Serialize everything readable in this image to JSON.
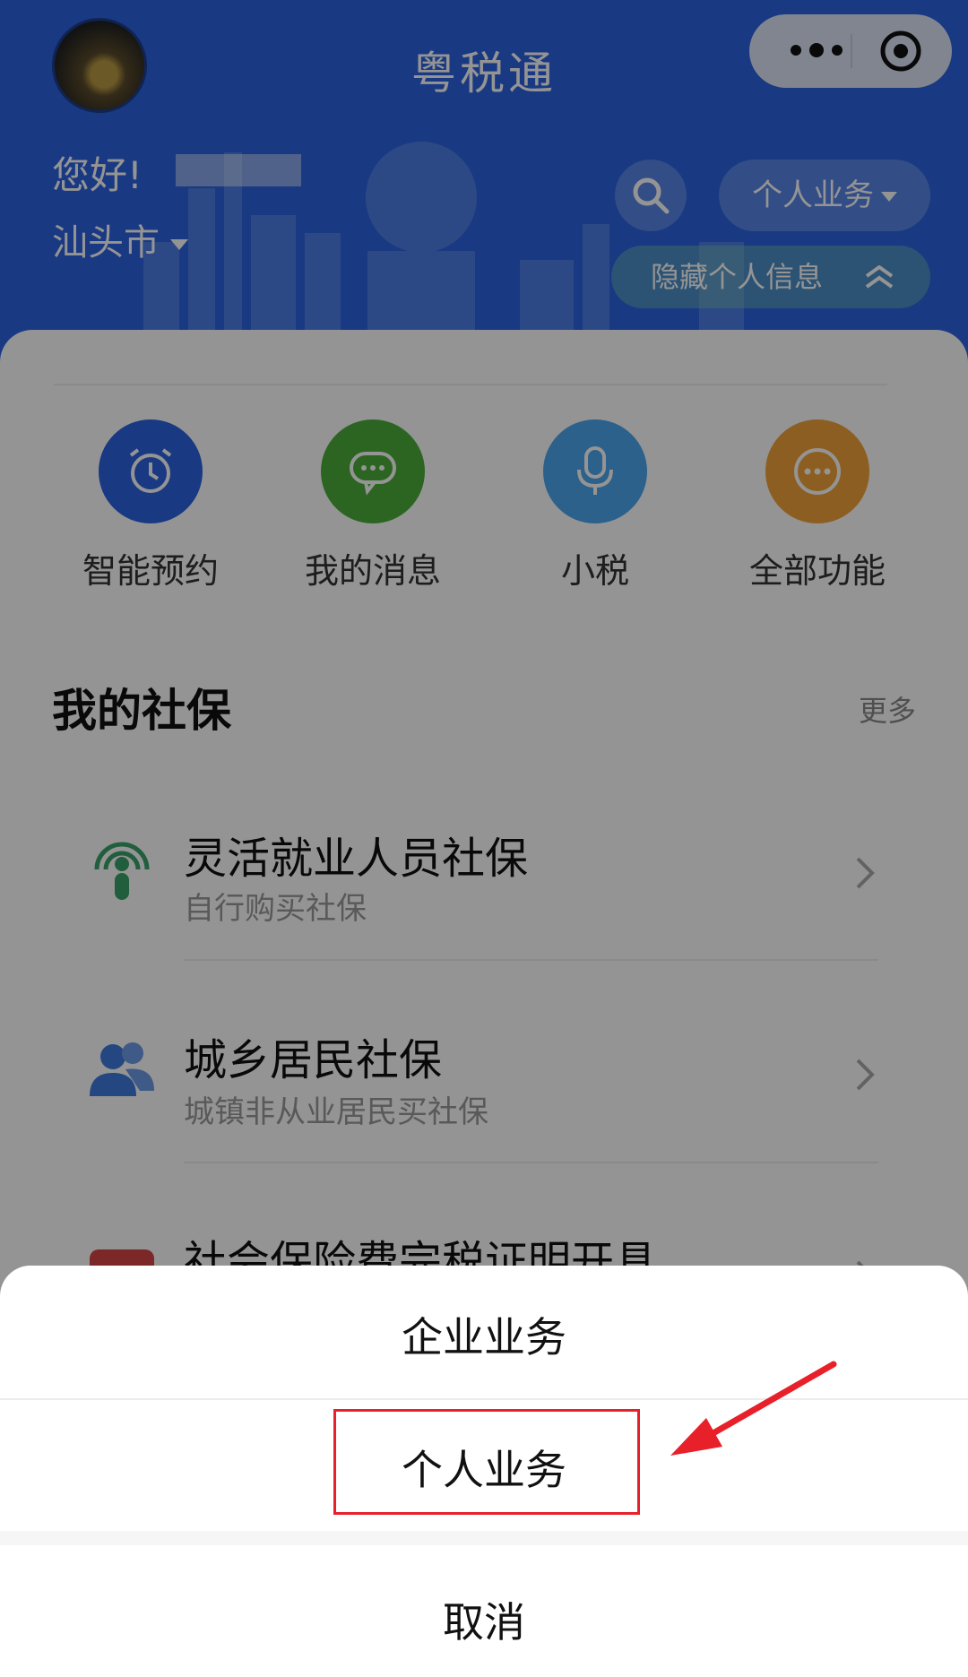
{
  "header": {
    "app_title": "粤税通",
    "greeting": "您好!",
    "city": "汕头市",
    "business_type": "个人业务",
    "hide_info": "隐藏个人信息"
  },
  "features": [
    {
      "label": "智能预约",
      "icon": "alarm-clock-icon",
      "color": "#2b63e0"
    },
    {
      "label": "我的消息",
      "icon": "chat-bubble-icon",
      "color": "#4caf3a"
    },
    {
      "label": "小税",
      "icon": "microphone-icon",
      "color": "#4aa8f0"
    },
    {
      "label": "全部功能",
      "icon": "more-circle-icon",
      "color": "#f3a33a"
    }
  ],
  "social": {
    "title": "我的社保",
    "more": "更多",
    "items": [
      {
        "title": "灵活就业人员社保",
        "subtitle": "自行购买社保",
        "icon": "broadcast-person-icon"
      },
      {
        "title": "城乡居民社保",
        "subtitle": "城镇非从业居民买社保",
        "icon": "users-icon"
      },
      {
        "title": "社会保险费完税证明开具",
        "subtitle": "",
        "icon": "social-security-logo-icon"
      }
    ]
  },
  "action_sheet": {
    "option_company": "企业业务",
    "option_personal": "个人业务",
    "cancel": "取消"
  },
  "colors": {
    "header_bg": "#2b63e0",
    "highlight": "#e8202a"
  }
}
